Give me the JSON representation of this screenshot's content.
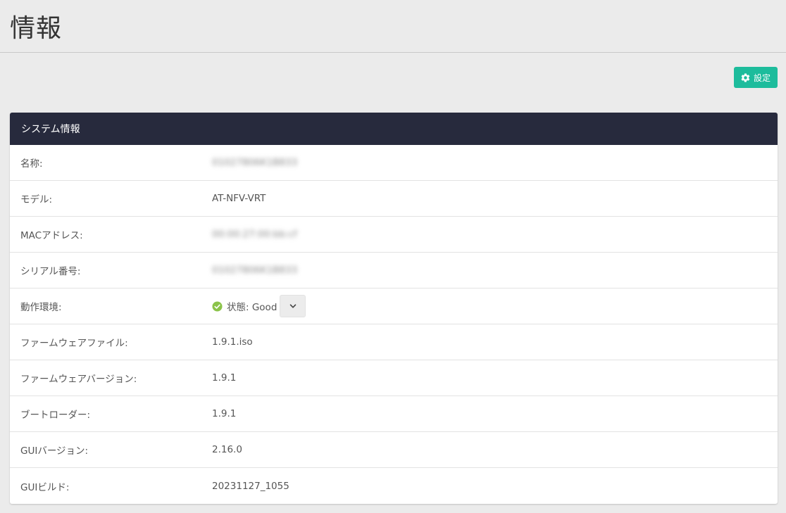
{
  "page": {
    "title": "情報"
  },
  "toolbar": {
    "settings_label": "設定",
    "settings_icon": "gear-icon"
  },
  "system_info": {
    "heading": "システム情報",
    "rows": [
      {
        "label": "名称:",
        "value": "01027806K1B833"
      },
      {
        "label": "モデル:",
        "value": "AT-NFV-VRT"
      },
      {
        "label": "MACアドレス:",
        "value": "00:00:27:00:bb:cf"
      },
      {
        "label": "シリアル番号:",
        "value": "01027806K1B833"
      },
      {
        "label": "動作環境:",
        "value": "状態: Good"
      },
      {
        "label": "ファームウェアファイル:",
        "value": "1.9.1.iso"
      },
      {
        "label": "ファームウェアバージョン:",
        "value": "1.9.1"
      },
      {
        "label": "ブートローダー:",
        "value": "1.9.1"
      },
      {
        "label": "GUIバージョン:",
        "value": "2.16.0"
      },
      {
        "label": "GUIビルド:",
        "value": "20231127_1055"
      }
    ]
  },
  "colors": {
    "accent": "#1dbc9c",
    "panel_heading": "#272a3d",
    "status_ok": "#8bc34a",
    "background": "#ebebeb"
  }
}
